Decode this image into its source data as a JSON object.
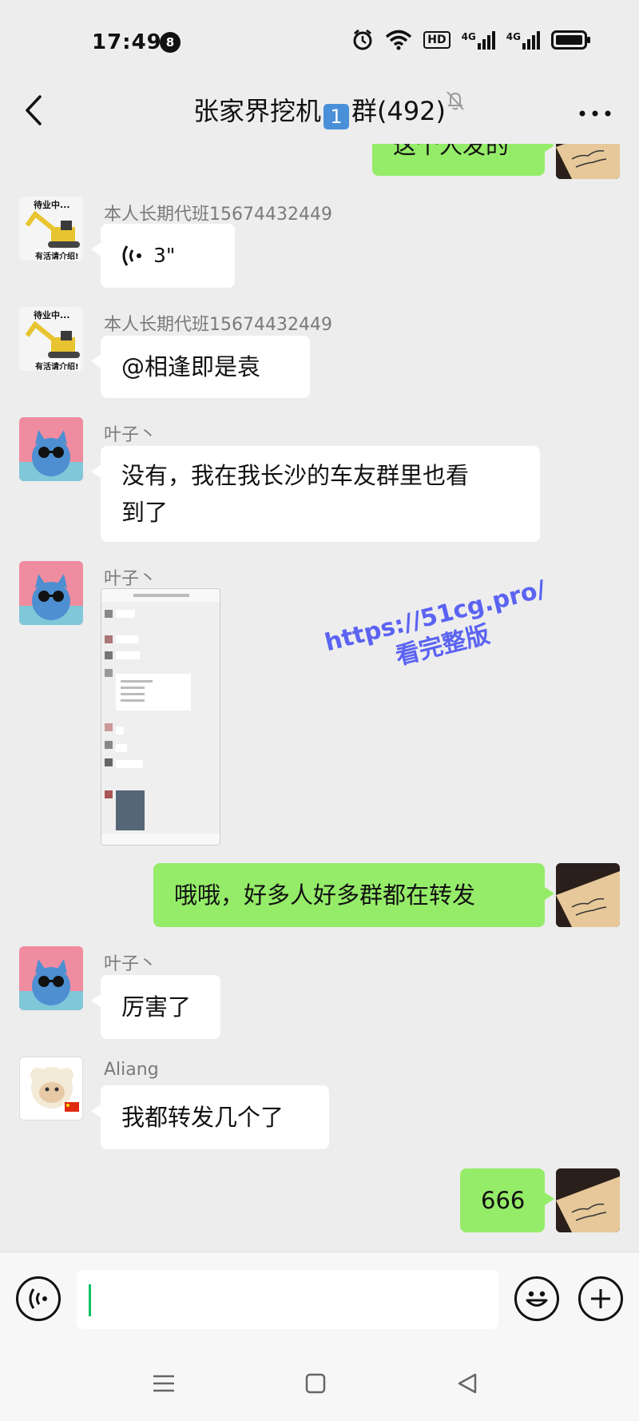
{
  "status_bar": {
    "time": "17:49",
    "notification_count": "8",
    "network_labels": [
      "HD",
      "4G",
      "4G"
    ]
  },
  "header": {
    "title_prefix": "张家界挖机",
    "title_emoji": "1",
    "title_suffix": "群(492)"
  },
  "messages": [
    {
      "type": "text",
      "direction": "out",
      "text": "这个人发的",
      "avatar": "paper-avatar"
    },
    {
      "type": "voice",
      "direction": "in",
      "sender": "本人长期代班15674432449",
      "duration": "3\"",
      "avatar": "excavator-avatar",
      "avatar_text_top": "待业中...",
      "avatar_text_bottom": "有活请介绍!"
    },
    {
      "type": "text",
      "direction": "in",
      "sender": "本人长期代班15674432449",
      "text": "@相逢即是袁",
      "avatar": "excavator-avatar",
      "avatar_text_top": "待业中...",
      "avatar_text_bottom": "有活请介绍!"
    },
    {
      "type": "text",
      "direction": "in",
      "sender": "叶子丶",
      "text_line1": "没有，我在我长沙的车友群里也看",
      "text_line2": "到了",
      "avatar": "cat-avatar"
    },
    {
      "type": "image",
      "direction": "in",
      "sender": "叶子丶",
      "avatar": "cat-avatar"
    },
    {
      "type": "text",
      "direction": "out",
      "text": "哦哦，好多人好多群都在转发",
      "avatar": "paper-avatar"
    },
    {
      "type": "text",
      "direction": "in",
      "sender": "叶子丶",
      "text": "厉害了",
      "avatar": "cat-avatar"
    },
    {
      "type": "text",
      "direction": "in",
      "sender": "Aliang",
      "text": "我都转发几个了",
      "avatar": "sheep-avatar"
    },
    {
      "type": "text",
      "direction": "out",
      "text": "666",
      "avatar": "paper-avatar"
    }
  ],
  "watermark": {
    "line1": "https://51cg.pro/",
    "line2": "看完整版"
  },
  "input": {
    "value": "",
    "placeholder": ""
  },
  "colors": {
    "background": "#ededed",
    "outgoing_bubble": "#95ec69",
    "incoming_bubble": "#ffffff",
    "caret": "#07c160",
    "watermark": "#5b63f2"
  }
}
